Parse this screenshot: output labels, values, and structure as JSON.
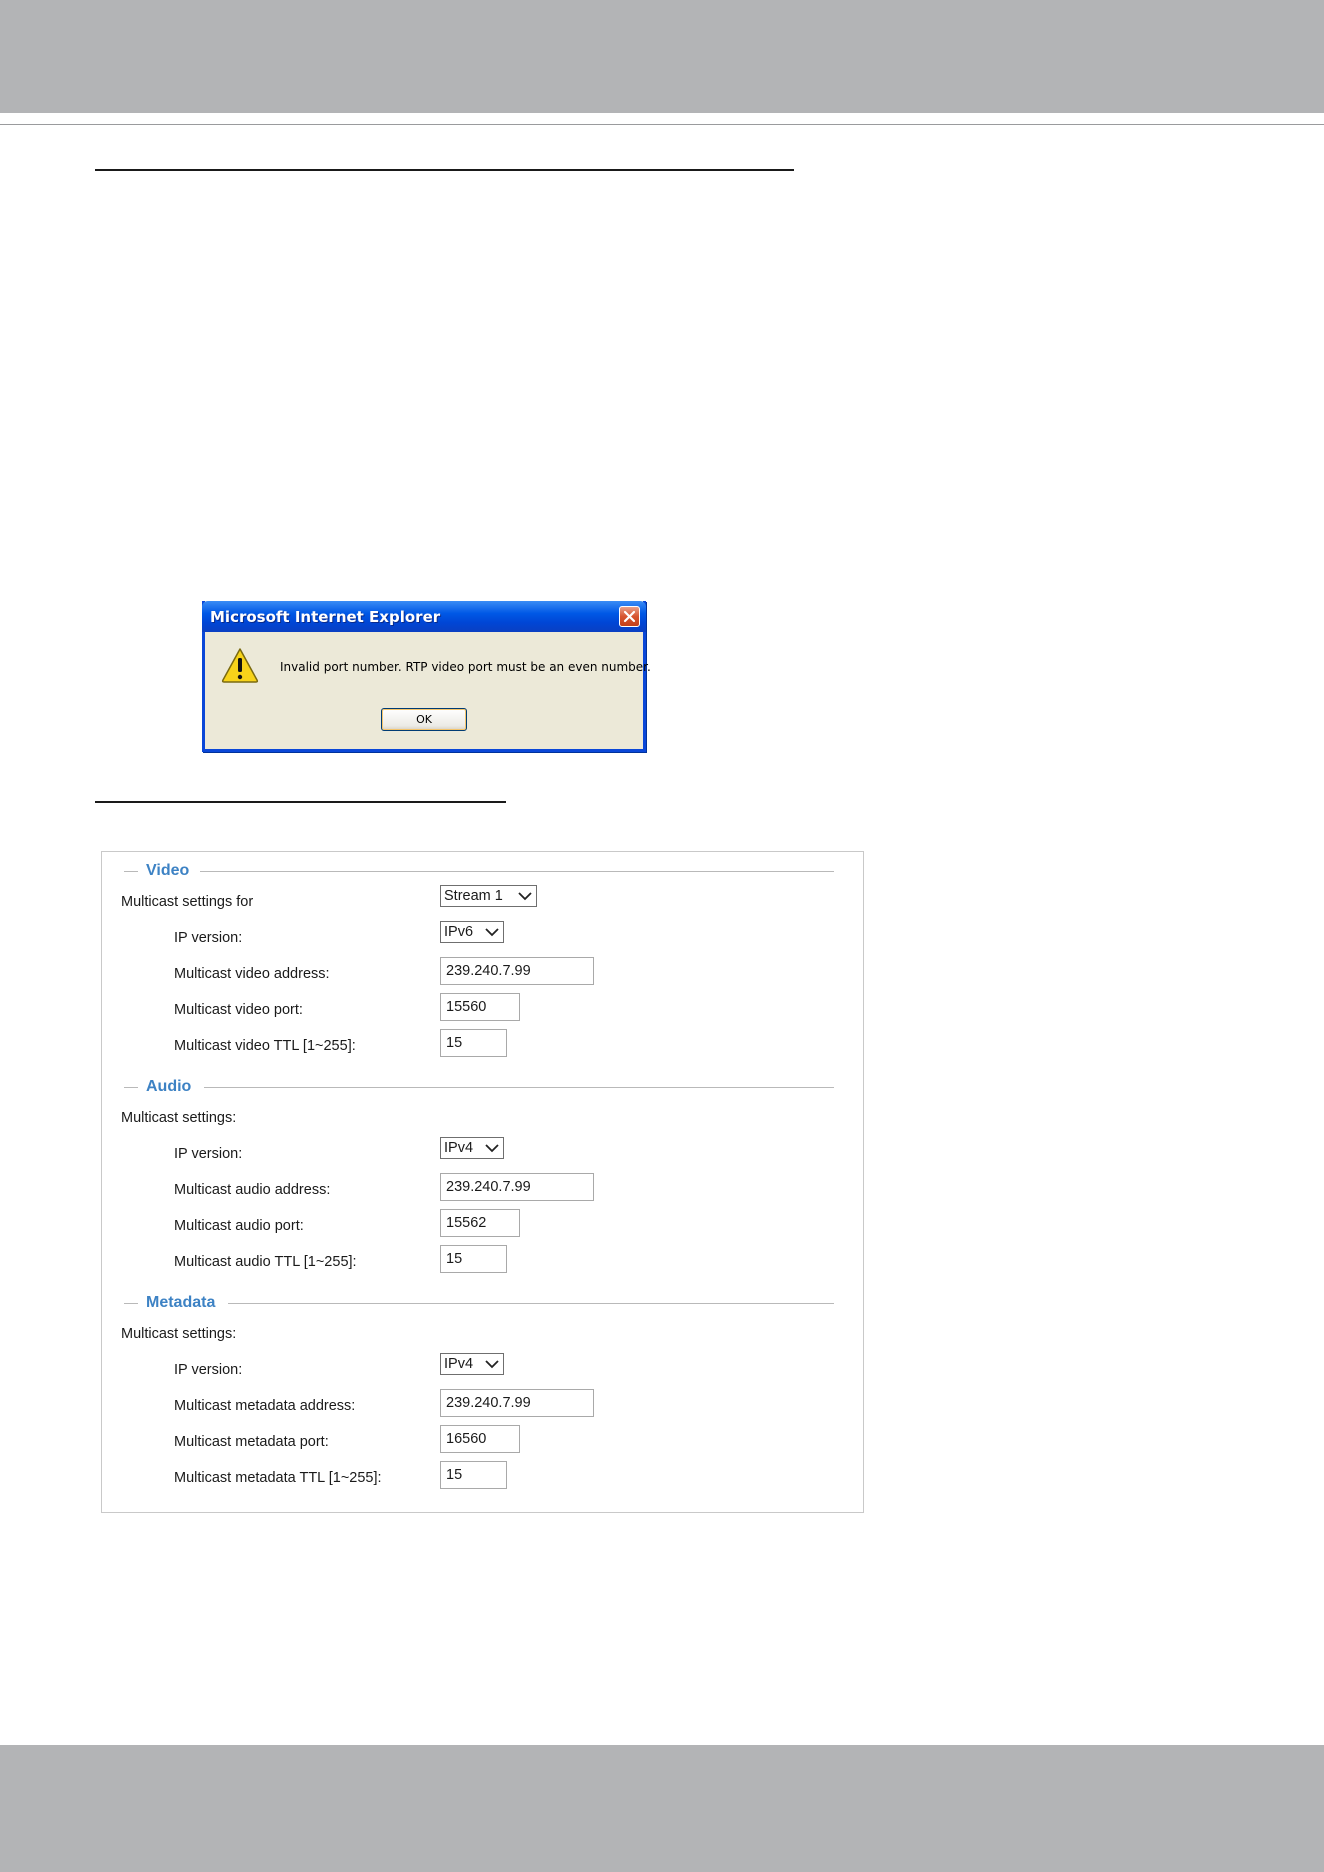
{
  "dialog": {
    "title": "Microsoft Internet Explorer",
    "message": "Invalid port number. RTP video port must be an even number.",
    "ok_label": "OK"
  },
  "video": {
    "heading": "Video",
    "settings_label": "Multicast settings for",
    "stream_select": "Stream 1",
    "ip_version_label": "IP version:",
    "ip_version": "IPv6",
    "address_label": "Multicast video address:",
    "address": "239.240.7.99",
    "port_label": "Multicast video port:",
    "port": "15560",
    "ttl_label": "Multicast video TTL [1~255]:",
    "ttl": "15"
  },
  "audio": {
    "heading": "Audio",
    "settings_label": "Multicast settings:",
    "ip_version_label": "IP version:",
    "ip_version": "IPv4",
    "address_label": "Multicast audio address:",
    "address": "239.240.7.99",
    "port_label": "Multicast audio port:",
    "port": "15562",
    "ttl_label": "Multicast audio TTL [1~255]:",
    "ttl": "15"
  },
  "metadata": {
    "heading": "Metadata",
    "settings_label": "Multicast settings:",
    "ip_version_label": "IP version:",
    "ip_version": "IPv4",
    "address_label": "Multicast metadata address:",
    "address": "239.240.7.99",
    "port_label": "Multicast metadata port:",
    "port": "16560",
    "ttl_label": "Multicast metadata TTL [1~255]:",
    "ttl": "15"
  },
  "colors": {
    "header_band": "#b3b4b6",
    "section_title": "#3d82c4",
    "xp_titlebar": "#0058e6"
  }
}
